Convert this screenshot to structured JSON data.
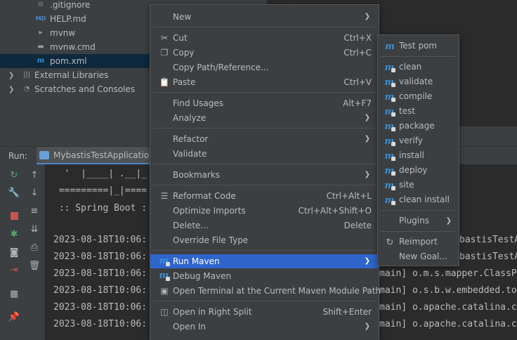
{
  "project_tree": {
    "items": [
      {
        "label": ".gitignore",
        "icon": "gitignore-icon"
      },
      {
        "label": "HELP.md",
        "icon": "markdown-icon"
      },
      {
        "label": "mvnw",
        "icon": "script-icon"
      },
      {
        "label": "mvnw.cmd",
        "icon": "script-icon"
      },
      {
        "label": "pom.xml",
        "icon": "maven-icon"
      },
      {
        "label": "External Libraries",
        "icon": "library-icon"
      },
      {
        "label": "Scratches and Consoles",
        "icon": "scratches-icon"
      }
    ]
  },
  "run_panel": {
    "label": "Run:",
    "tab_label": "MybastisTestApplication"
  },
  "console": {
    "lines": [
      "  '  |____| .__|_",
      " =========|_|====",
      " :: Spring Boot :",
      "",
      "2023-08-18T10:06:",
      "2023-08-18T10:06:",
      "2023-08-18T10:06:",
      "2023-08-18T10:06:",
      "2023-08-18T10:06:",
      "2023-08-18T10:06:"
    ],
    "right_lines": [
      "bastisTestA",
      "bastisTestA",
      "main] o.m.s.mapper.ClassP",
      "main] o.s.b.w.embedded.to",
      "main] o.apache.catalina.c",
      "main] o.apache.catalina.c"
    ]
  },
  "context_menu": {
    "items": [
      {
        "label": "New",
        "shortcut": "",
        "submenu": true,
        "icon": ""
      },
      {
        "label": "Cut",
        "shortcut": "Ctrl+X",
        "submenu": false,
        "icon": "scissors-icon"
      },
      {
        "label": "Copy",
        "shortcut": "Ctrl+C",
        "submenu": false,
        "icon": "copy-icon"
      },
      {
        "label": "Copy Path/Reference...",
        "shortcut": "",
        "submenu": false,
        "icon": ""
      },
      {
        "label": "Paste",
        "shortcut": "Ctrl+V",
        "submenu": false,
        "icon": "paste-icon"
      },
      {
        "label": "Find Usages",
        "shortcut": "Alt+F7",
        "submenu": false,
        "icon": ""
      },
      {
        "label": "Analyze",
        "shortcut": "",
        "submenu": true,
        "icon": ""
      },
      {
        "label": "Refactor",
        "shortcut": "",
        "submenu": true,
        "icon": ""
      },
      {
        "label": "Validate",
        "shortcut": "",
        "submenu": false,
        "icon": ""
      },
      {
        "label": "Bookmarks",
        "shortcut": "",
        "submenu": true,
        "icon": ""
      },
      {
        "label": "Reformat Code",
        "shortcut": "Ctrl+Alt+L",
        "submenu": false,
        "icon": "reformat-icon"
      },
      {
        "label": "Optimize Imports",
        "shortcut": "Ctrl+Alt+Shift+O",
        "submenu": false,
        "icon": ""
      },
      {
        "label": "Delete...",
        "shortcut": "Delete",
        "submenu": false,
        "icon": ""
      },
      {
        "label": "Override File Type",
        "shortcut": "",
        "submenu": false,
        "icon": ""
      },
      {
        "label": "Run Maven",
        "shortcut": "",
        "submenu": true,
        "icon": "maven-run-icon"
      },
      {
        "label": "Debug Maven",
        "shortcut": "",
        "submenu": false,
        "icon": "maven-debug-icon"
      },
      {
        "label": "Open Terminal at the Current Maven Module Path",
        "shortcut": "",
        "submenu": false,
        "icon": "terminal-icon"
      },
      {
        "label": "Open in Right Split",
        "shortcut": "Shift+Enter",
        "submenu": false,
        "icon": "split-icon"
      },
      {
        "label": "Open In",
        "shortcut": "",
        "submenu": true,
        "icon": ""
      }
    ]
  },
  "maven_submenu": {
    "items": [
      {
        "label": "Test pom",
        "icon": "maven-icon"
      },
      {
        "label": "clean",
        "icon": "maven-goal-icon"
      },
      {
        "label": "validate",
        "icon": "maven-goal-icon"
      },
      {
        "label": "compile",
        "icon": "maven-goal-icon"
      },
      {
        "label": "test",
        "icon": "maven-goal-icon"
      },
      {
        "label": "package",
        "icon": "maven-goal-icon"
      },
      {
        "label": "verify",
        "icon": "maven-goal-icon"
      },
      {
        "label": "install",
        "icon": "maven-goal-icon"
      },
      {
        "label": "deploy",
        "icon": "maven-goal-icon"
      },
      {
        "label": "site",
        "icon": "maven-goal-icon"
      },
      {
        "label": "clean install",
        "icon": "maven-goal-icon"
      },
      {
        "label": "Plugins",
        "icon": ""
      },
      {
        "label": "Reimport",
        "icon": "reimport-icon"
      },
      {
        "label": "New Goal...",
        "icon": ""
      }
    ]
  },
  "colors": {
    "selection": "#2f65ca",
    "maven_blue": "#3b8fd5",
    "panel": "#3c3f41",
    "editor": "#2b2b2b"
  }
}
